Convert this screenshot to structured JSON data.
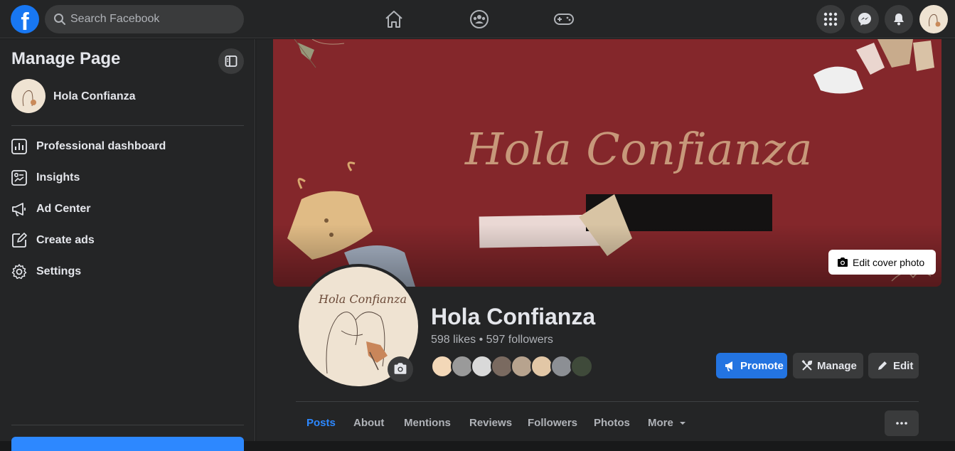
{
  "topbar": {
    "logo_letter": "f",
    "search_placeholder": "Search Facebook",
    "nav_icons": [
      "home-icon",
      "groups-icon",
      "gaming-icon"
    ],
    "right_icons": [
      "menu-grid-icon",
      "messenger-icon",
      "notifications-icon",
      "account-avatar"
    ]
  },
  "sidebar": {
    "title": "Manage Page",
    "page_name": "Hola Confianza",
    "items": [
      {
        "label": "Professional dashboard",
        "icon": "dashboard-icon"
      },
      {
        "label": "Insights",
        "icon": "insights-icon"
      },
      {
        "label": "Ad Center",
        "icon": "megaphone-icon"
      },
      {
        "label": "Create ads",
        "icon": "pencil-square-icon"
      },
      {
        "label": "Settings",
        "icon": "gear-icon"
      }
    ]
  },
  "cover": {
    "title": "Hola Confianza",
    "edit_label": "Edit cover photo",
    "background": "#84272b"
  },
  "profile": {
    "avatar_text": "Hola Confianza",
    "name": "Hola Confianza",
    "stats": "598 likes • 597 followers"
  },
  "actions": {
    "promote": "Promote",
    "manage": "Manage",
    "edit": "Edit"
  },
  "tabs": [
    {
      "label": "Posts",
      "active": true
    },
    {
      "label": "About",
      "active": false
    },
    {
      "label": "Mentions",
      "active": false
    },
    {
      "label": "Reviews",
      "active": false
    },
    {
      "label": "Followers",
      "active": false
    },
    {
      "label": "Photos",
      "active": false
    },
    {
      "label": "More",
      "active": false
    }
  ],
  "colors": {
    "accent": "#2374e1",
    "background": "#18191a",
    "surface": "#242526"
  }
}
